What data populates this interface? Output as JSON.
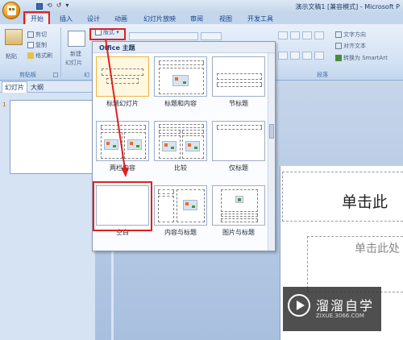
{
  "window": {
    "title": "演示文稿1 [兼容模式] - Microsoft P"
  },
  "quick_access": [
    "⟲",
    "↺",
    "▾"
  ],
  "ribbon_tabs": [
    {
      "label": "开始",
      "active": true
    },
    {
      "label": "插入"
    },
    {
      "label": "设计"
    },
    {
      "label": "动画"
    },
    {
      "label": "幻灯片放映"
    },
    {
      "label": "审阅"
    },
    {
      "label": "视图"
    },
    {
      "label": "开发工具"
    }
  ],
  "clipboard": {
    "paste_label": "粘贴",
    "cut_label": "剪切",
    "copy_label": "复制",
    "format_painter_label": "格式刷",
    "group_label": "剪贴板"
  },
  "slides_group": {
    "new_slide_line1": "新建",
    "new_slide_line2": "幻灯片",
    "layout_button_label": "版式",
    "group_label_partial": "幻"
  },
  "paragraph": {
    "text_direction_label": "文字方向",
    "align_text_label": "对齐文本",
    "smartart_label": "转换为 SmartArt",
    "group_label": "段落"
  },
  "panel_tabs": [
    {
      "label": "幻灯片",
      "active": true
    },
    {
      "label": "大纲"
    }
  ],
  "thumbnail": {
    "number": "1"
  },
  "layout_popup": {
    "header": "Office 主题",
    "layouts": [
      {
        "name": "标题幻灯片",
        "selected": true
      },
      {
        "name": "标题和内容"
      },
      {
        "name": "节标题"
      },
      {
        "name": "两栏内容"
      },
      {
        "name": "比较"
      },
      {
        "name": "仅标题"
      },
      {
        "name": "空白"
      },
      {
        "name": "内容与标题"
      },
      {
        "name": "图片与标题"
      }
    ]
  },
  "slide": {
    "title_placeholder": "单击此",
    "subtitle_placeholder": "单击此处"
  },
  "watermark": {
    "name": "溜溜自学",
    "url": "ZIXUE.3066.COM"
  },
  "colors": {
    "highlight_red": "#e02020",
    "ribbon_blue": "#15428b",
    "selected_layout": "#f1b43b"
  }
}
